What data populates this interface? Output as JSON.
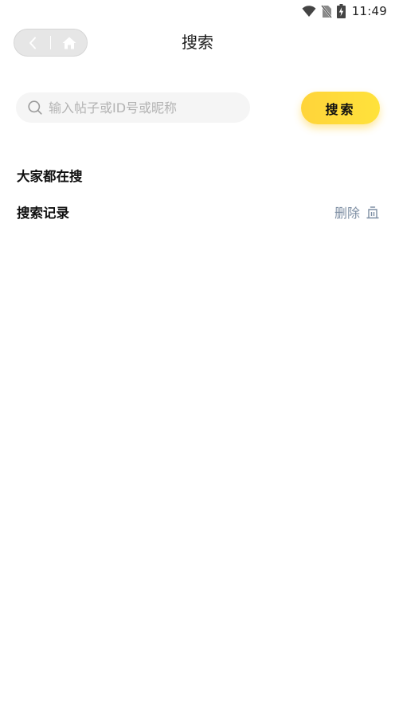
{
  "status_bar": {
    "time": "11:49",
    "icons": [
      "wifi-icon",
      "no-sim-icon",
      "battery-charging-icon"
    ]
  },
  "nav": {
    "back_icon": "chevron-left-icon",
    "home_icon": "home-icon",
    "title": "搜索"
  },
  "search": {
    "placeholder": "输入帖子或ID号或昵称",
    "value": "",
    "icon": "search-icon",
    "button_label": "搜索"
  },
  "sections": {
    "hot_searches_title": "大家都在搜",
    "history_title": "搜索记录",
    "delete_label": "删除",
    "delete_icon": "trash-icon"
  },
  "colors": {
    "accent": "#ffd83a",
    "delete_text": "#7d8ea3",
    "search_bg": "#f5f5f5",
    "nav_pill_bg": "#e6e6e6"
  }
}
